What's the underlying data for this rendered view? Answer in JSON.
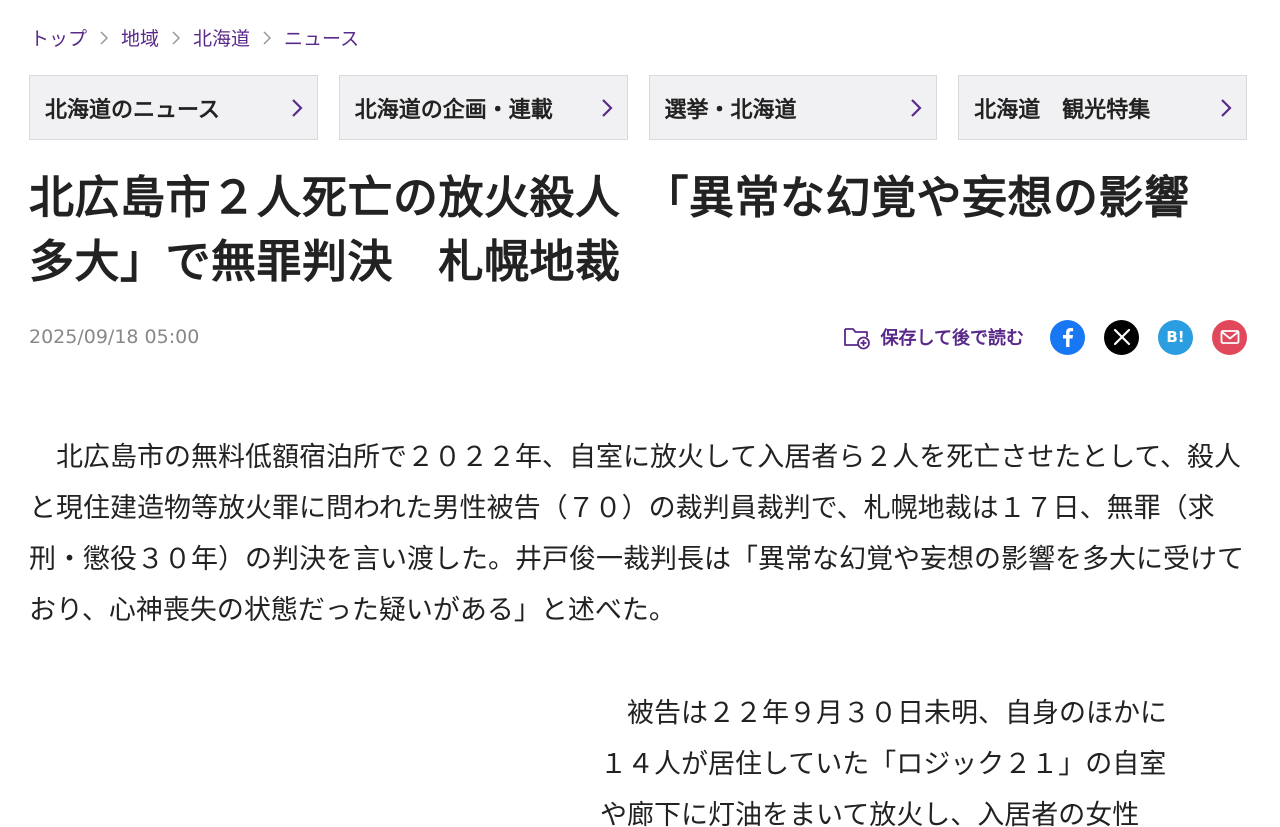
{
  "breadcrumb": {
    "items": [
      "トップ",
      "地域",
      "北海道",
      "ニュース"
    ]
  },
  "categories": [
    {
      "label": "北海道のニュース"
    },
    {
      "label": "北海道の企画・連載"
    },
    {
      "label": "選挙・北海道"
    },
    {
      "label": "北海道　観光特集"
    }
  ],
  "article": {
    "headline_line1": "北広島市２人死亡の放火殺人　「異常な幻覚や妄想の影響",
    "headline_line2": "多大」で無罪判決　札幌地裁",
    "date": "2025/09/18 05:00",
    "save_label": "保存して後で読む",
    "paragraph1": "　北広島市の無料低額宿泊所で２０２２年、自室に放火して入居者ら２人を死亡させたとして、殺人と現住建造物等放火罪に問われた男性被告（７０）の裁判員裁判で、札幌地裁は１７日、無罪（求刑・懲役３０年）の判決を言い渡した。井戸俊一裁判長は「異常な幻覚や妄想の影響を多大に受けており、心神喪失の状態だった疑いがある」と述べた。",
    "paragraph2_line1": "　被告は２２年９月３０日未明、自身のほかに",
    "paragraph2_line2": "１４人が居住していた「ロジック２１」の自室",
    "paragraph2_line3": "や廊下に灯油をまいて放火し、入居者の女性"
  },
  "share": {
    "hatena_label": "B!"
  },
  "icons": {
    "save": "folder-plus-icon",
    "facebook": "facebook-icon",
    "x": "x-icon",
    "hatena": "hatena-bookmark-icon",
    "mail": "mail-icon"
  },
  "colors": {
    "link": "#5a2a8a",
    "facebook": "#1877f2",
    "x": "#000000",
    "hatena": "#2a9ee0",
    "mail": "#e2485b"
  }
}
